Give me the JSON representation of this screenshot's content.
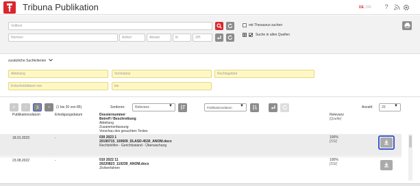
{
  "header": {
    "app_title": "Tribuna Publikation",
    "lang_active": "DE",
    "lang_other": "FR",
    "icons": [
      "help-icon",
      "rss-icon",
      "gear-icon"
    ]
  },
  "search": {
    "volltext_placeholder": "Volltext",
    "normen_placeholder": "Normen",
    "artikel_placeholder": "Artikel",
    "absatz_placeholder": "Absatz",
    "lit_placeholder": "lit.",
    "ziff_placeholder": "Ziff.",
    "thesaurus_label": "mit Thesaurus suchen",
    "all_sources_label": "Suche in allen Quellen",
    "thesaurus_checked": false,
    "all_sources_checked": true
  },
  "extra": {
    "toggle_label": "zusätzliche Suchkriterien",
    "abteilung_placeholder": "Abteilung",
    "vorinstanz_placeholder": "Vorinstanz",
    "rechtsgebiet_placeholder": "Rechtsgebiet",
    "entscheiddatum_placeholder": "Entscheiddatum von",
    "bis_placeholder": "bis"
  },
  "results": {
    "range_text": "(1 bis 20 von 85)",
    "current_page": "3",
    "sort_label": "Sortieren:",
    "sort_value": "Relevanz",
    "sort2_value": "Publikationsdatum",
    "anzahl_label": "Anzahl:",
    "anzahl_value": "20"
  },
  "columns": {
    "pub_date": "Publikationsdatum",
    "erl_date": "Erledigungsdatum",
    "dossier": "Dossiernummer",
    "betreff": "Betreff / Beschreibung",
    "abteilung": "Abteilung",
    "zusammenfassung": "Zusammenfassung",
    "vorschau": "Vorschau des gesuchten Textes",
    "relevanz": "Relevanz",
    "quelle": "[Quelle]"
  },
  "rows": [
    {
      "pub_date": "18.01.2023",
      "erl_date": "-",
      "dossier": "030 2023 1",
      "file": "20190715_100609_DLASD-4530_ANOM.docx",
      "desc": "Rechtshilfen - Gerichtsstand - Überwachung",
      "relevanz": "100%",
      "quelle": "[SSI]"
    },
    {
      "pub_date": "23.08.2022",
      "erl_date": "-",
      "dossier": "010 2022 11",
      "file": "20220823_110239_ANOM.docx",
      "desc": "Zivilverfahren",
      "relevanz": "100%",
      "quelle": "[SSI]"
    }
  ],
  "colors": {
    "brand_red": "#d9272e",
    "highlight_blue": "#3a57c8",
    "criteria_yellow": "#fff8c6"
  }
}
